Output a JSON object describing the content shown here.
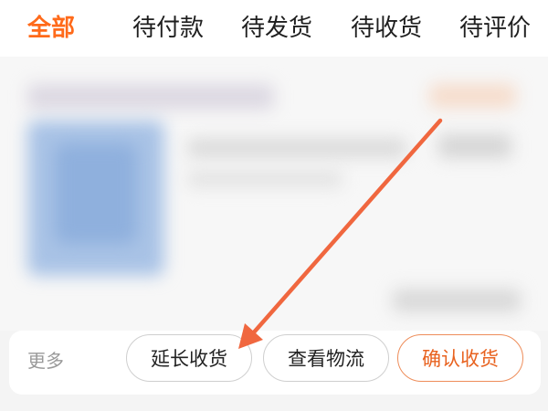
{
  "tabs": [
    {
      "label": "全部",
      "active": true
    },
    {
      "label": "待付款",
      "active": false
    },
    {
      "label": "待发货",
      "active": false
    },
    {
      "label": "待收货",
      "active": false
    },
    {
      "label": "待评价",
      "active": false
    }
  ],
  "actions": {
    "more_label": "更多",
    "extend_label": "延长收货",
    "track_label": "查看物流",
    "confirm_label": "确认收货"
  },
  "colors": {
    "accent": "#ff6a1a",
    "annotation_arrow": "#f0673f"
  }
}
